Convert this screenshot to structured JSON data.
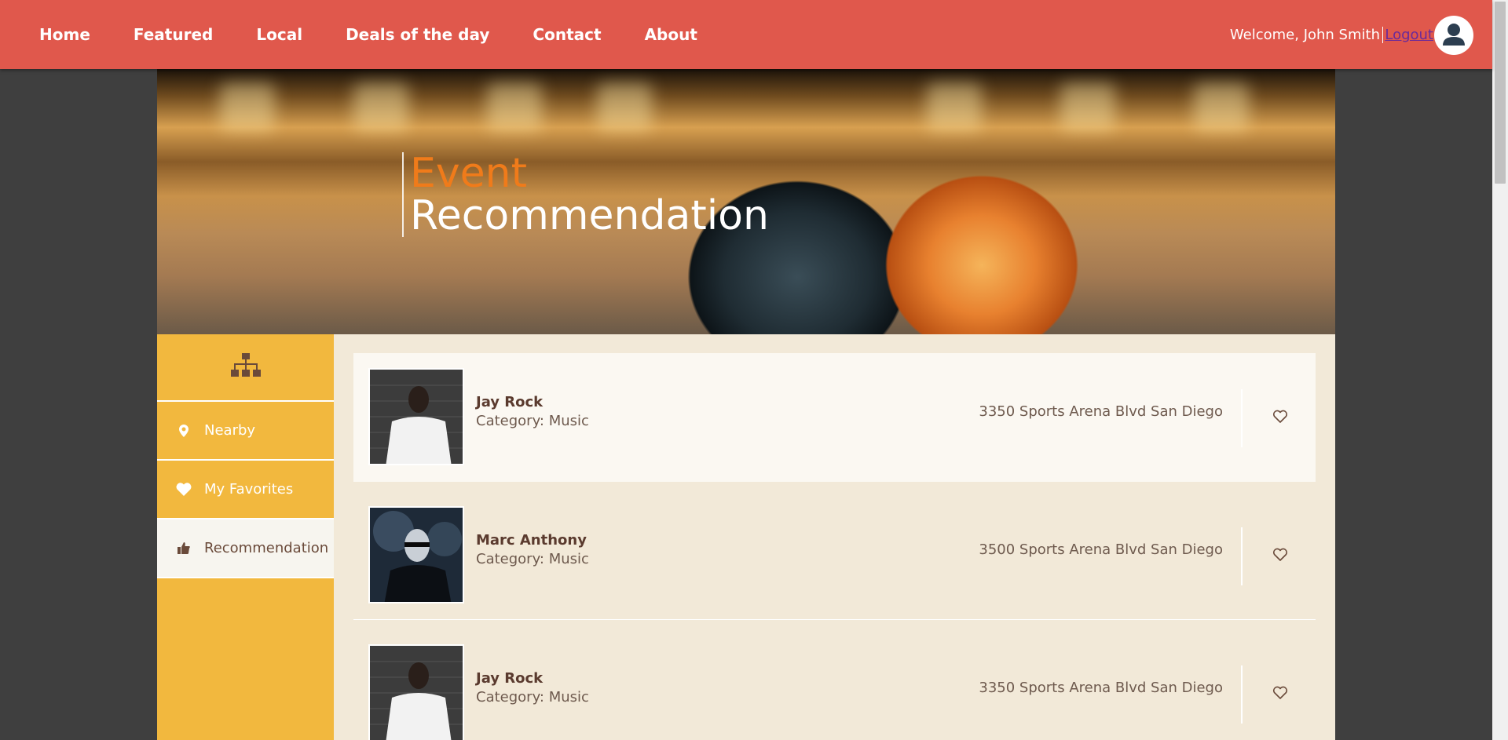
{
  "nav": {
    "items": [
      {
        "label": "Home"
      },
      {
        "label": "Featured"
      },
      {
        "label": "Local"
      },
      {
        "label": "Deals of the day"
      },
      {
        "label": "Contact"
      },
      {
        "label": "About"
      }
    ],
    "welcome": "Welcome, John Smith",
    "logout": "Logout"
  },
  "hero": {
    "line1": "Event",
    "line2": "Recommendation"
  },
  "sidebar": {
    "top_icon": "sitemap-icon",
    "items": [
      {
        "label": "Nearby",
        "icon": "map-marker-icon"
      },
      {
        "label": "My Favorites",
        "icon": "heart-icon"
      },
      {
        "label": "Recommendation",
        "icon": "thumbs-up-icon",
        "active": true
      }
    ]
  },
  "events": [
    {
      "name": "Jay Rock",
      "category": "Category: Music",
      "address": "3350 Sports Arena Blvd San Diego",
      "photo": "person-white-shirt"
    },
    {
      "name": "Marc Anthony",
      "category": "Category: Music",
      "address": "3500 Sports Arena Blvd San Diego",
      "photo": "person-sunglasses"
    },
    {
      "name": "Jay Rock",
      "category": "Category: Music",
      "address": "3350 Sports Arena Blvd San Diego",
      "photo": "person-white-shirt"
    }
  ],
  "colors": {
    "topbar": "#e0584c",
    "sidebar": "#f2b83e",
    "content_bg": "#f2e9d8",
    "hero_accent": "#f07b1a"
  }
}
